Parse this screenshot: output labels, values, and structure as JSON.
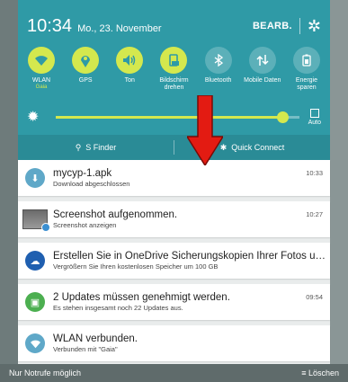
{
  "header": {
    "time": "10:34",
    "date": "Mo., 23. November",
    "edit_label": "BEARB.",
    "settings_icon": "gear-icon"
  },
  "toggles": [
    {
      "label": "WLAN",
      "sub": "Gaia",
      "icon": "wifi-icon",
      "state": "on"
    },
    {
      "label": "GPS",
      "sub": "",
      "icon": "location-icon",
      "state": "on"
    },
    {
      "label": "Ton",
      "sub": "",
      "icon": "volume-icon",
      "state": "on"
    },
    {
      "label": "Bildschirm drehen",
      "sub": "",
      "icon": "rotate-icon",
      "state": "on"
    },
    {
      "label": "Bluetooth",
      "sub": "",
      "icon": "bluetooth-icon",
      "state": "off"
    },
    {
      "label": "Mobile Daten",
      "sub": "",
      "icon": "mobile-data-icon",
      "state": "off"
    },
    {
      "label": "Energie sparen",
      "sub": "",
      "icon": "battery-icon",
      "state": "off"
    }
  ],
  "brightness": {
    "level": 0.93,
    "auto_label": "Auto"
  },
  "bottom_actions": {
    "finder": "S Finder",
    "quick_connect": "Quick Connect"
  },
  "notifications": [
    {
      "title": "mycyp-1.apk",
      "text": "Download abgeschlossen",
      "time": "10:33",
      "icon": "download-icon",
      "color": "#5fa8c8"
    },
    {
      "title": "Screenshot aufgenommen.",
      "text": "Screenshot anzeigen",
      "time": "10:27",
      "icon": "screenshot-thumb",
      "color": "#3b8fd1"
    },
    {
      "title": "Erstellen Sie in OneDrive Sicherungskopien Ihrer Fotos und V...",
      "text": "Vergrößern Sie Ihren kostenlosen Speicher um 100 GB",
      "time": "",
      "icon": "cloud-icon",
      "color": "#1f5fb0"
    },
    {
      "title": "2 Updates müssen genehmigt werden.",
      "text": "Es stehen insgesamt noch 22 Updates aus.",
      "time": "09:54",
      "icon": "store-icon",
      "color": "#4caf50"
    },
    {
      "title": "WLAN verbunden.",
      "text": "Verbunden mit \"Gaia\"",
      "time": "",
      "icon": "wifi-icon",
      "color": "#5fa8c8"
    }
  ],
  "status": {
    "left": "Nur Notrufe möglich",
    "clear": "Löschen"
  },
  "colors": {
    "accent": "#d4e84e",
    "panel": "#2f9aa6",
    "arrow": "#e31b12"
  }
}
